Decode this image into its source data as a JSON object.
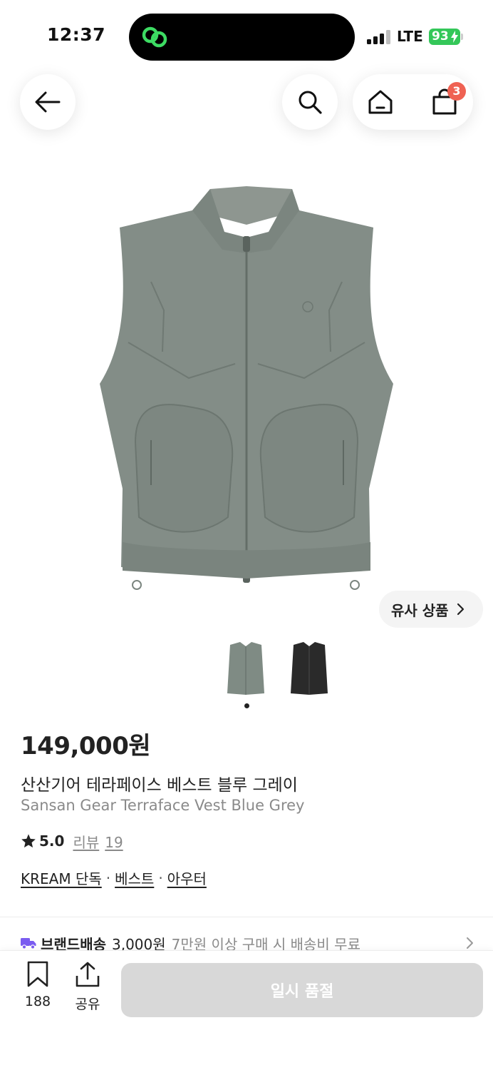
{
  "status_bar": {
    "time": "12:37",
    "network": "LTE",
    "battery": "93",
    "battery_color": "#34c759"
  },
  "header": {
    "back_icon": "arrow-left-icon",
    "search_icon": "search-icon",
    "home_icon": "home-icon",
    "cart_icon": "shopping-bag-icon",
    "cart_badge": "3",
    "badge_color": "#ef6253"
  },
  "product": {
    "similar_label": "유사 상품",
    "price": "149,000원",
    "name_ko": "산산기어 테라페이스 베스트 블루 그레이",
    "name_en": "Sansan Gear Terraface Vest Blue Grey",
    "rating": "5.0",
    "review_label": "리뷰",
    "review_count": "19",
    "tags": [
      "KREAM 단독",
      "베스트",
      "아우터"
    ],
    "tag_separator": "·",
    "thumbnails": [
      {
        "color": "#7f8b84",
        "selected": true
      },
      {
        "color": "#2a2a2a",
        "selected": false
      }
    ]
  },
  "shipping": {
    "label": "브랜드배송",
    "fee": "3,000원",
    "note": "7만원 이상 구매 시 배송비 무료",
    "icon_color": "#7a5cf0"
  },
  "bottom_bar": {
    "bookmark_count": "188",
    "share_label": "공유",
    "cta_label": "일시 품절"
  }
}
